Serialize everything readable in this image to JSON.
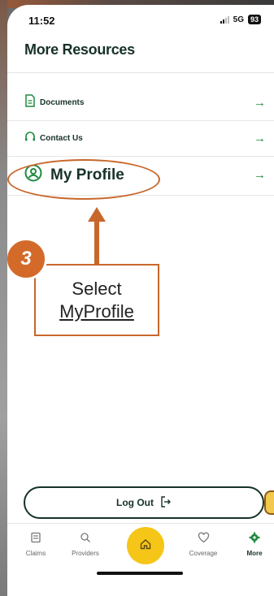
{
  "status_bar": {
    "time": "11:52",
    "network": "5G",
    "battery": "93"
  },
  "page": {
    "title": "More Resources"
  },
  "menu": {
    "items": [
      {
        "label": "Documents",
        "icon": "document-icon"
      },
      {
        "label": "Contact Us",
        "icon": "headset-icon"
      },
      {
        "label": "My Profile",
        "icon": "profile-icon"
      }
    ]
  },
  "annotation": {
    "step_number": "3",
    "line1": "Select",
    "line2": "MyProfile",
    "color": "#c8672a"
  },
  "logout": {
    "label": "Log Out",
    "icon": "logout-icon"
  },
  "tabbar": {
    "items": [
      {
        "label": "Claims",
        "icon": "claims-icon"
      },
      {
        "label": "Providers",
        "icon": "search-icon"
      },
      {
        "label": "",
        "icon": "home-icon"
      },
      {
        "label": "Coverage",
        "icon": "heart-icon"
      },
      {
        "label": "More",
        "icon": "gear-icon",
        "active": true
      }
    ]
  },
  "colors": {
    "brand_dark": "#173228",
    "accent_green": "#1f8a3f",
    "home_yellow": "#f5c518"
  }
}
